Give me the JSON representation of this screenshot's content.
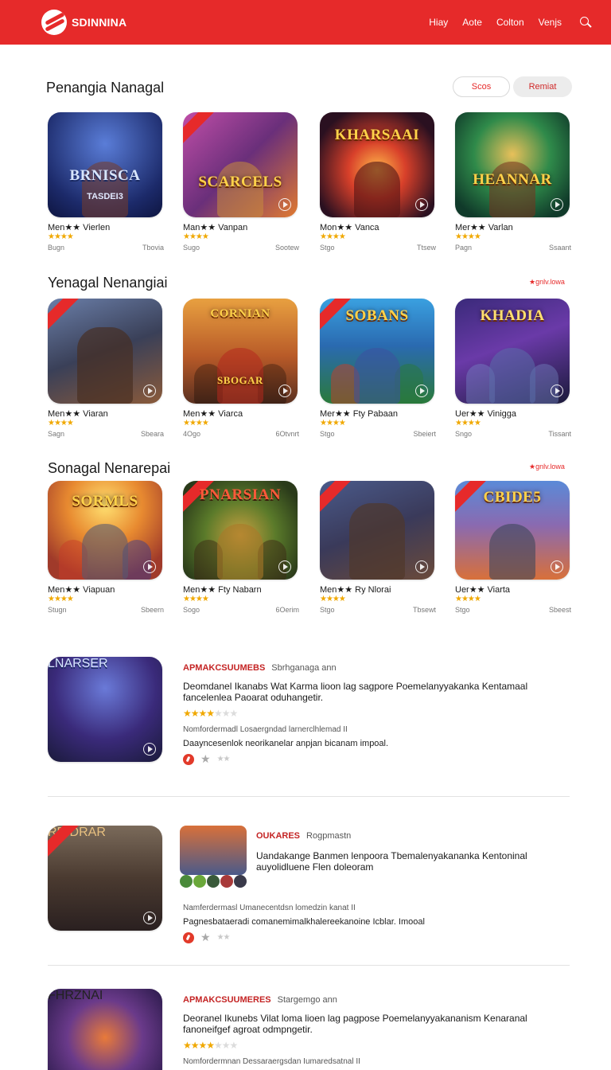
{
  "header": {
    "brand": "SDINNINA",
    "nav": [
      "Hiay",
      "Aote",
      "Colton",
      "Venjs"
    ]
  },
  "sections": [
    {
      "title": "Penangia Nanagal",
      "filters": [
        "Scos",
        "Remiat"
      ],
      "cards": [
        {
          "name": "Men★★ Vierlen",
          "stars": "★★★★",
          "left": "Bugn",
          "right": "Tbovia",
          "art": "BRNISCA",
          "sub": "TASDEI3"
        },
        {
          "name": "Man★★ Vanpan",
          "stars": "★★★★",
          "left": "Sugo",
          "right": "Sootew",
          "art": "SCARCELS",
          "sub": ""
        },
        {
          "name": "Mon★★ Vanca",
          "stars": "★★★★",
          "left": "Stgo",
          "right": "Ttsew",
          "art": "KHARSAAI",
          "sub": ""
        },
        {
          "name": "Mer★★ Varlan",
          "stars": "★★★★",
          "left": "Pagn",
          "right": "Ssaant",
          "art": "HEANNAR",
          "sub": ""
        }
      ]
    },
    {
      "title": "Yenagal Nenangiai",
      "link": "★gnlv.lowa",
      "cards": [
        {
          "name": "Men★★ Viaran",
          "stars": "★★★★",
          "left": "Sagn",
          "right": "Sbeara",
          "art": "",
          "sub": ""
        },
        {
          "name": "Men★★ Viarca",
          "stars": "★★★★",
          "left": "4Ogo",
          "right": "6Otvnrt",
          "art": "CORNIAN",
          "sub": "SBOGAR"
        },
        {
          "name": "Mer★★ Fty Pabaan",
          "stars": "★★★★",
          "left": "Stgo",
          "right": "Sbeiert",
          "art": "SOBANS",
          "sub": ""
        },
        {
          "name": "Uer★★ Vinigga",
          "stars": "★★★★",
          "left": "Sngo",
          "right": "Tissant",
          "art": "KHADIA",
          "sub": ""
        }
      ]
    },
    {
      "title": "Sonagal Nenarepai",
      "link": "★gnlv.lowa",
      "cards": [
        {
          "name": "Men★★ Viapuan",
          "stars": "★★★★",
          "left": "Stugn",
          "right": "Sbeern",
          "art": "SORMLS",
          "sub": ""
        },
        {
          "name": "Men★★ Fty Nabarn",
          "stars": "★★★★",
          "left": "Sogo",
          "right": "6Oerim",
          "art": "PNARSIAN",
          "sub": ""
        },
        {
          "name": "Men★★ Ry Nlorai",
          "stars": "★★★★",
          "left": "Stgo",
          "right": "Tbsewt",
          "art": "",
          "sub": ""
        },
        {
          "name": "Uer★★ Viarta",
          "stars": "★★★★",
          "left": "Stgo",
          "right": "Sbeest",
          "art": "CBIDE5",
          "sub": ""
        }
      ]
    }
  ],
  "featured": [
    {
      "tag": "APMAKCSUUMEBS",
      "sub": "Sbrhganaga ann",
      "desc": "Deomdanel Ikanabs Wat Karma lioon lag sagpore Poemelanyyakanka Kentamaal fancelenlea Paoarat oduhangetir.",
      "stars_on": "★★★★",
      "stars_off": "★★★",
      "note": "Nomfordermadl Losaergndad larnerclhlemad II",
      "note2": "Daayncesenlok neorikanelar anpjan bicanam impoal.",
      "art": "LNARSER"
    },
    {
      "tag": "OUKARES",
      "sub": "Rogpmastn",
      "desc": "Uandakange Banmen lenpoora Tbemalenyakananka Kentoninal auyolidluene Flen doleoram",
      "note": "Namferdermasl Umanecentdsn lomedzin kanat II",
      "note2": "Pagnesbataeradi comanemimalkhalereekanoine Icblar. Imooal",
      "art": "RRIDRAR"
    },
    {
      "tag": "APMAKCSUUMERES",
      "sub": "Stargemgo ann",
      "desc": "Deoranel Ikunebs Vilat loma lioen lag pagpose Poemelanyyakananism Kenaranal fanoneifgef agroat odmpngetir.",
      "stars_on": "★★★★",
      "stars_off": "★★★",
      "note": "Nomfordermnan Dessaraergsdan Iumaredsatnal II",
      "art": "FHRZNAI"
    }
  ],
  "colors": {
    "brand": "#e62a2a",
    "star": "#f0a800"
  },
  "icons": [
    "logo-icon",
    "search-icon",
    "play-icon",
    "star-icon"
  ]
}
